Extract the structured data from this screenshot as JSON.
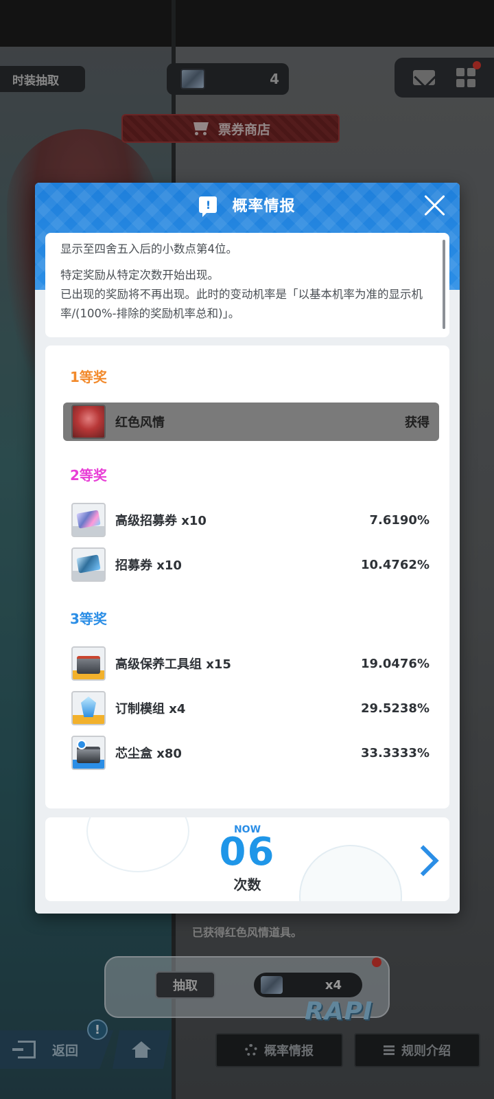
{
  "background": {
    "costume_tab": "时装抽取",
    "ticket_count": "4",
    "shop_banner": "票券商店",
    "status_text": "已获得红色风情道具。",
    "pull_button": "抽取",
    "pull_cost": "x4",
    "back_button": "返回",
    "notice_badge": "!",
    "rates_button": "概率情报",
    "rules_button": "规则介绍"
  },
  "modal": {
    "title": "概率情报",
    "notice": {
      "line1": "显示至四舍五入后的小数点第4位。",
      "line2": "特定奖励从特定次数开始出现。",
      "line3": "已出现的奖励将不再出现。此时的变动机率是「以基本机率为准的显示机率/(100%-排除的奖励机率总和)」。"
    },
    "tiers": [
      {
        "heading": "1等奖",
        "color": "#f28a2c",
        "rewards": [
          {
            "name": "红色风情",
            "status": "获得",
            "obtained": true
          }
        ]
      },
      {
        "heading": "2等奖",
        "color": "#e83ed6",
        "rewards": [
          {
            "name": "高级招募券 x10",
            "rate": "7.6190%"
          },
          {
            "name": "招募券 x10",
            "rate": "10.4762%"
          }
        ]
      },
      {
        "heading": "3等奖",
        "color": "#2b8ee6",
        "rewards": [
          {
            "name": "高级保养工具组 x15",
            "rate": "19.0476%"
          },
          {
            "name": "订制模组 x4",
            "rate": "29.5238%"
          },
          {
            "name": "芯尘盒 x80",
            "rate": "33.3333%"
          }
        ]
      }
    ],
    "count": {
      "now_label": "NOW",
      "value": "06",
      "label": "次数"
    }
  },
  "colors": {
    "accent_blue": "#2b8ee6",
    "tier1_orange": "#f28a2c",
    "tier2_pink": "#e83ed6",
    "obtained_row": "#7a7a7a"
  }
}
